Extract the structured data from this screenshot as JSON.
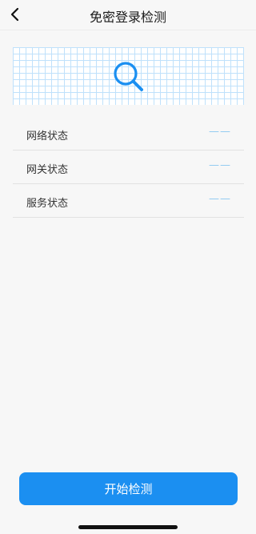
{
  "header": {
    "title": "免密登录检测"
  },
  "status_list": [
    {
      "label": "网络状态",
      "value": "——"
    },
    {
      "label": "网关状态",
      "value": "——"
    },
    {
      "label": "服务状态",
      "value": "——"
    }
  ],
  "actions": {
    "start_label": "开始检测"
  },
  "colors": {
    "accent": "#1b8ff1",
    "grid_line": "#bfe1fb",
    "placeholder_value": "#8ec9f2"
  },
  "icons": {
    "back": "chevron-left-icon",
    "banner": "search-icon"
  }
}
